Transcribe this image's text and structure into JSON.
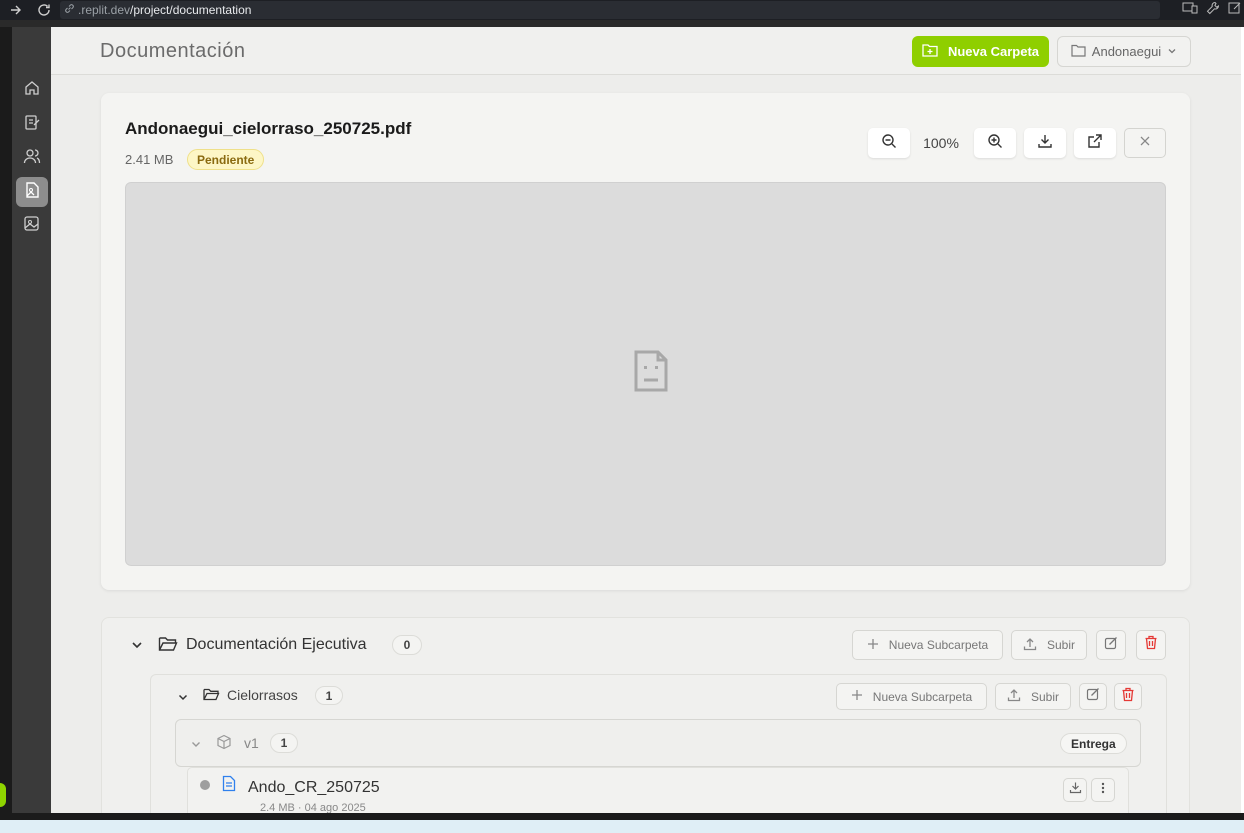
{
  "browser": {
    "url_domain": ".replit.dev",
    "url_path": "/project/documentation"
  },
  "header": {
    "title": "Documentación",
    "new_folder_label": "Nueva Carpeta",
    "project_label": "Andonaegui"
  },
  "viewer": {
    "file_name": "Andonaegui_cielorraso_250725.pdf",
    "file_size": "2.41 MB",
    "status": "Pendiente",
    "zoom": "100%"
  },
  "folders": {
    "main": {
      "name": "Documentación Ejecutiva",
      "count": "0",
      "new_subfolder_label": "Nueva Subcarpeta",
      "upload_label": "Subir"
    },
    "sub": {
      "name": "Cielorrasos",
      "count": "1",
      "new_subfolder_label": "Nueva Subcarpeta",
      "upload_label": "Subir"
    },
    "version": {
      "name": "v1",
      "count": "1",
      "tag": "Entrega"
    },
    "file": {
      "name": "Ando_CR_250725",
      "meta": "2.4 MB · 04 ago 2025"
    }
  },
  "colors": {
    "accent": "#8fcf00",
    "danger": "#e53935",
    "sidebar": "#3a3a3a"
  }
}
